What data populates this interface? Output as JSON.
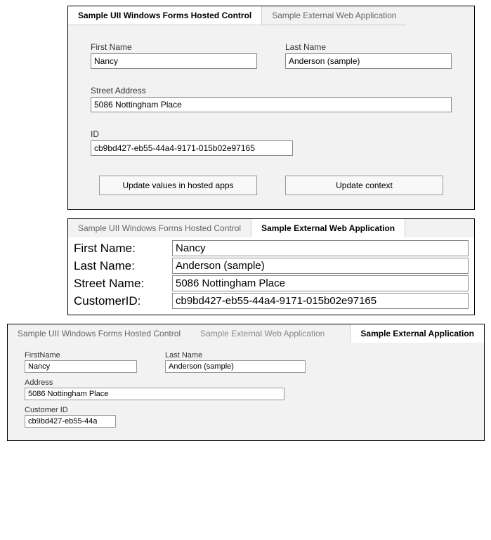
{
  "panel1": {
    "tab_active": "Sample UII Windows Forms Hosted Control",
    "tab_inactive": "Sample External Web Application",
    "first_name_label": "First Name",
    "first_name_value": "Nancy",
    "last_name_label": "Last Name",
    "last_name_value": "Anderson (sample)",
    "street_label": "Street Address",
    "street_value": "5086 Nottingham Place",
    "id_label": "ID",
    "id_value": "cb9bd427-eb55-44a4-9171-015b02e97165",
    "btn_update_apps": "Update values in hosted apps",
    "btn_update_ctx": "Update context"
  },
  "panel2": {
    "tab_inactive": "Sample UII Windows Forms Hosted Control",
    "tab_active": "Sample External Web Application",
    "rows": {
      "first_name_label": "First Name:",
      "first_name_value": "Nancy",
      "last_name_label": "Last Name:",
      "last_name_value": "Anderson (sample)",
      "street_label": "Street Name:",
      "street_value": "5086 Nottingham Place",
      "cust_label": "CustomerID:",
      "cust_value": "cb9bd427-eb55-44a4-9171-015b02e97165"
    }
  },
  "panel3": {
    "tab1": "Sample UII Windows Forms Hosted Control",
    "tab2": "Sample External Web Application",
    "tab_active": "Sample External Application",
    "first_name_label": "FirstName",
    "first_name_value": "Nancy",
    "last_name_label": "Last Name",
    "last_name_value": "Anderson (sample)",
    "address_label": "Address",
    "address_value": "5086 Nottingham Place",
    "cust_label": "Customer ID",
    "cust_value": "cb9bd427-eb55-44a"
  }
}
